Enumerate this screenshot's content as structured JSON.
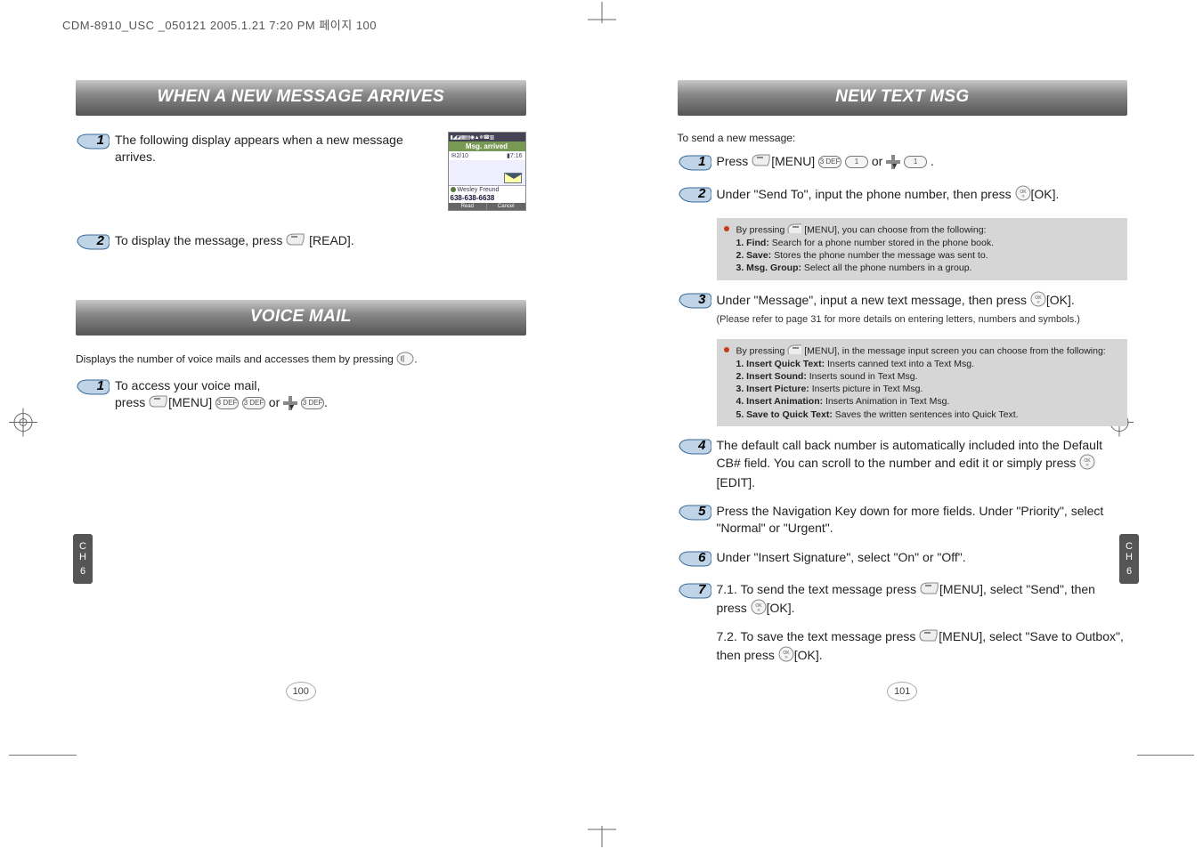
{
  "header": "CDM-8910_USC _050121  2005.1.21 7:20 PM  페이지 100",
  "left_page": {
    "section1_title": "WHEN A NEW MESSAGE ARRIVES",
    "step1": "The following display appears when a new message arrives.",
    "step2_pre": "To display the message, press",
    "step2_key": "[READ].",
    "phone": {
      "title": "Msg. arrived",
      "count": "2/10",
      "time": "7:16",
      "sender": "Wesley Freund",
      "number": "638-638-6638",
      "btn_left": "Read",
      "btn_right": "Cancel"
    },
    "section2_title": "VOICE MAIL",
    "vm_intro": "Displays the number of voice mails and accesses them by pressing",
    "vm_step1_a": "To access your voice mail,",
    "vm_step1_b": "press",
    "vm_menu": "[MENU]",
    "vm_or": "or",
    "side_tab": "CH\n6",
    "page_num": "100"
  },
  "right_page": {
    "section_title": "NEW TEXT MSG",
    "intro": "To send a new message:",
    "step1_a": "Press",
    "step1_menu": "[MENU]",
    "step1_or": "or",
    "step2_a": "Under \"Send To\", input the phone number, then press",
    "step2_ok": "[OK].",
    "box1_lead": "By pressing",
    "box1_lead2": "[MENU], you can choose from the following:",
    "box1_1": "1. Find:",
    "box1_1t": " Search for a phone number stored in the phone book.",
    "box1_2": "2. Save:",
    "box1_2t": " Stores the phone number the message was sent to.",
    "box1_3": "3. Msg. Group:",
    "box1_3t": " Select all the phone numbers in a group.",
    "step3_a": "Under \"Message\", input a new text message, then press",
    "step3_ok": "[OK].",
    "step3_note": "(Please refer to page 31 for more details on entering letters, numbers and symbols.)",
    "box2_lead": "By pressing",
    "box2_lead2": "[MENU], in the message input screen you can choose from the following:",
    "box2_1": "1.  Insert Quick Text:",
    "box2_1t": " Inserts canned text into a Text Msg.",
    "box2_2": "2.  Insert Sound:",
    "box2_2t": " Inserts sound in Text Msg.",
    "box2_3": "3.  Insert Picture:",
    "box2_3t": " Inserts picture in Text Msg.",
    "box2_4": "4.  Insert Animation:",
    "box2_4t": " Inserts Animation in Text Msg.",
    "box2_5": "5.  Save to Quick Text:",
    "box2_5t": " Saves the written sentences into Quick Text.",
    "step4": "The default call back number is automatically included into the Default CB# field. You can scroll to the number and edit it or simply press",
    "step4_edit": "[EDIT].",
    "step5": "Press the Navigation Key down for more fields. Under \"Priority\", select \"Normal\" or \"Urgent\".",
    "step6": "Under \"Insert Signature\", select \"On\" or \"Off\".",
    "step7_1a": "7.1. To send the text message press",
    "step7_1b": "[MENU], select \"Send\", then press",
    "step7_1ok": "[OK].",
    "step7_2a": "7.2. To save the text message press",
    "step7_2b": "[MENU], select \"Save to Outbox\", then press",
    "step7_2ok": "[OK].",
    "side_tab": "CH\n6",
    "page_num": "101"
  },
  "keys": {
    "3def": "3 DEF",
    "1": "1"
  }
}
